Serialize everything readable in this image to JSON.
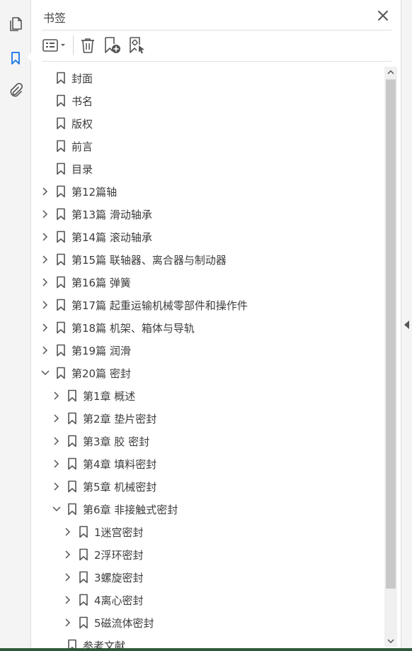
{
  "panel": {
    "title": "书签"
  },
  "bookmarks": [
    {
      "label": "封面",
      "level": 0,
      "expand": "none"
    },
    {
      "label": "书名",
      "level": 0,
      "expand": "none"
    },
    {
      "label": "版权",
      "level": 0,
      "expand": "none"
    },
    {
      "label": "前言",
      "level": 0,
      "expand": "none"
    },
    {
      "label": "目录",
      "level": 0,
      "expand": "none"
    },
    {
      "label": "第12篇轴",
      "level": 0,
      "expand": "collapsed"
    },
    {
      "label": "第13篇  滑动轴承",
      "level": 0,
      "expand": "collapsed"
    },
    {
      "label": "第14篇  滚动轴承",
      "level": 0,
      "expand": "collapsed"
    },
    {
      "label": "第15篇  联轴器、离合器与制动器",
      "level": 0,
      "expand": "collapsed"
    },
    {
      "label": "第16篇  弹簧",
      "level": 0,
      "expand": "collapsed"
    },
    {
      "label": "第17篇  起重运输机械零部件和操作件",
      "level": 0,
      "expand": "collapsed"
    },
    {
      "label": "第18篇  机架、箱体与导轨",
      "level": 0,
      "expand": "collapsed"
    },
    {
      "label": "第19篇  润滑",
      "level": 0,
      "expand": "collapsed"
    },
    {
      "label": "第20篇  密封",
      "level": 0,
      "expand": "expanded"
    },
    {
      "label": "第1章  概述",
      "level": 1,
      "expand": "collapsed"
    },
    {
      "label": "第2章  垫片密封",
      "level": 1,
      "expand": "collapsed"
    },
    {
      "label": "第3章  胶  密封",
      "level": 1,
      "expand": "collapsed"
    },
    {
      "label": "第4章  填料密封",
      "level": 1,
      "expand": "collapsed"
    },
    {
      "label": "第5章  机械密封",
      "level": 1,
      "expand": "collapsed"
    },
    {
      "label": "第6章  非接触式密封",
      "level": 1,
      "expand": "expanded"
    },
    {
      "label": "1迷宫密封",
      "level": 2,
      "expand": "collapsed"
    },
    {
      "label": "2浮环密封",
      "level": 2,
      "expand": "collapsed"
    },
    {
      "label": "3螺旋密封",
      "level": 2,
      "expand": "collapsed"
    },
    {
      "label": "4离心密封",
      "level": 2,
      "expand": "collapsed"
    },
    {
      "label": "5磁流体密封",
      "level": 2,
      "expand": "collapsed"
    },
    {
      "label": "参考文献",
      "level": 1,
      "expand": "none"
    }
  ],
  "colors": {
    "accent": "#1473e6",
    "icon": "#555555",
    "text": "#3c3c3c"
  },
  "icons": {
    "rail": [
      "pages-icon",
      "bookmark-icon",
      "attachment-icon"
    ],
    "toolbar": [
      "options-menu-icon",
      "delete-icon",
      "new-bookmark-icon",
      "bookmark-from-selection-icon"
    ],
    "close": "close-icon"
  }
}
